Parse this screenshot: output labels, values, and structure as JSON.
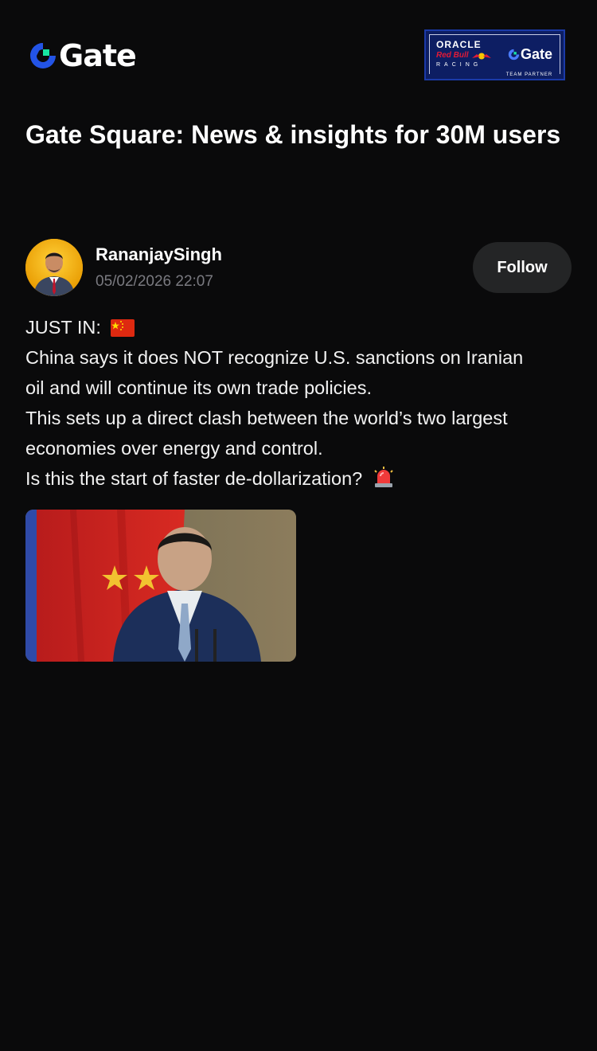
{
  "brand": {
    "logo_text": "Gate",
    "partner_badge": {
      "oracle": "ORACLE",
      "redbull": "Red Bull",
      "racing": "RACING",
      "gate_text": "Gate",
      "team_partner": "TEAM PARTNER"
    }
  },
  "page": {
    "title": "Gate Square: News & insights for 30M users"
  },
  "post": {
    "author": "RananjaySingh",
    "timestamp": "05/02/2026 22:07",
    "follow_label": "Follow",
    "lines": [
      "JUST IN:",
      "China says it does NOT recognize U.S. sanctions on Iranian",
      "oil and will continue its own trade policies.",
      "This sets up a direct clash between the world’s two largest",
      "economies over energy and control.",
      "Is this the start of faster de-dollarization?"
    ],
    "flag_icon": "china-flag-icon",
    "alert_icon": "rotating-light-icon"
  },
  "colors": {
    "background": "#0a0a0b",
    "accent_blue": "#2354e6",
    "accent_green": "#17e6a1",
    "follow_bg": "#242526",
    "muted_text": "#7a7a80"
  }
}
